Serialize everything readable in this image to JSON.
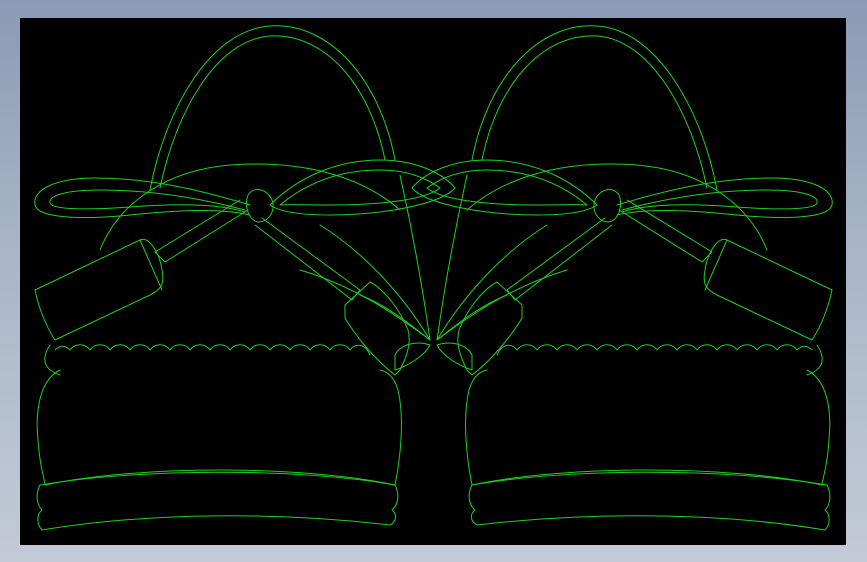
{
  "viewport": {
    "background": "#000000",
    "line_color": "#1fd11f",
    "frame_color": "#9aa9c0"
  }
}
